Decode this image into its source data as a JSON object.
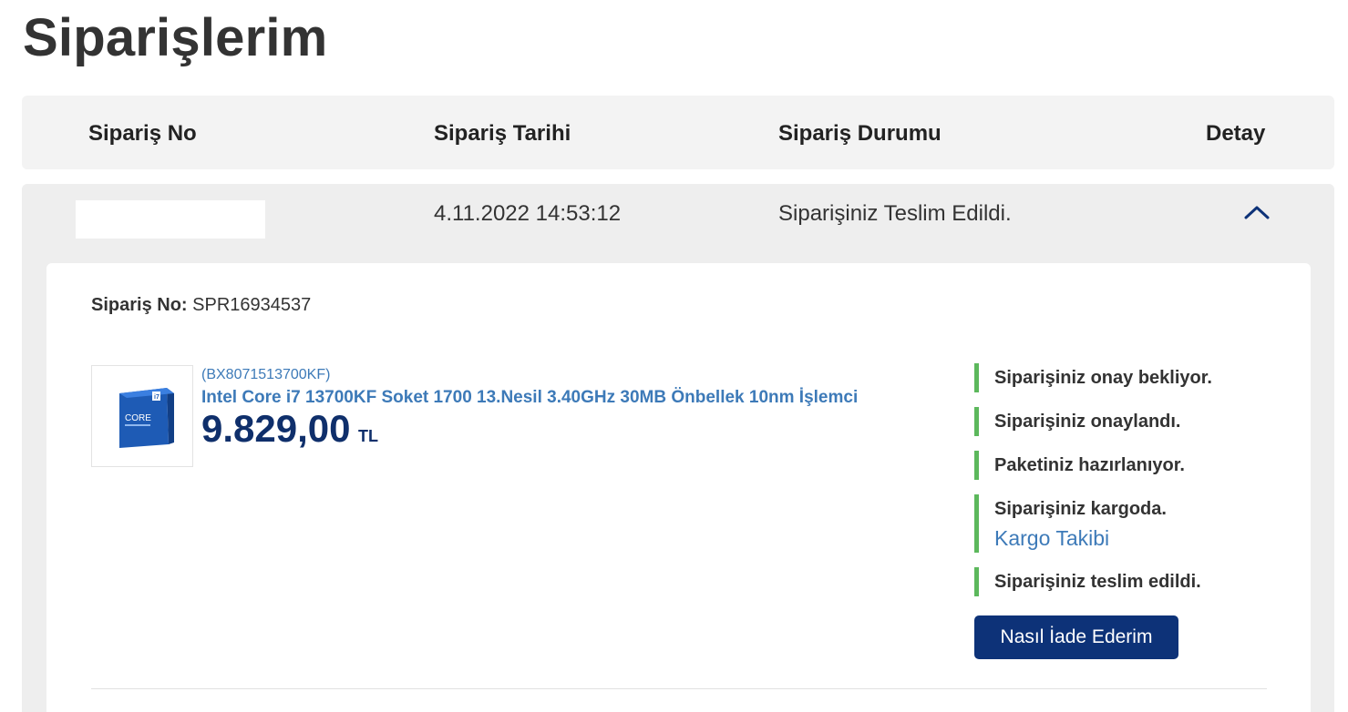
{
  "page": {
    "title": "Siparişlerim"
  },
  "table": {
    "headers": {
      "order_no": "Sipariş No",
      "order_date": "Sipariş Tarihi",
      "order_status": "Sipariş Durumu",
      "detail": "Detay"
    }
  },
  "order": {
    "date": "4.11.2022 14:53:12",
    "status": "Siparişiniz Teslim Edildi.",
    "detail": {
      "order_no_label": "Sipariş No:",
      "order_no_value": "SPR16934537",
      "product": {
        "code": "(BX8071513700KF)",
        "name": "Intel Core i7 13700KF Soket 1700 13.Nesil 3.40GHz 30MB Önbellek 10nm İşlemci",
        "price": "9.829,00",
        "currency": "TL",
        "image_icon": "cpu-box-icon"
      },
      "timeline": [
        {
          "text": "Siparişiniz onay bekliyor."
        },
        {
          "text": "Siparişiniz onaylandı."
        },
        {
          "text": "Paketiniz hazırlanıyor."
        },
        {
          "text": "Siparişiniz kargoda.",
          "link": "Kargo Takibi"
        },
        {
          "text": "Siparişiniz teslim edildi."
        }
      ],
      "return_button": "Nasıl İade Ederim"
    }
  },
  "colors": {
    "accent_navy": "#0d3278",
    "link_blue": "#3d7ab8",
    "price_navy": "#0f2f6b",
    "timeline_green": "#5cb85c",
    "header_bg": "#f3f3f3"
  }
}
